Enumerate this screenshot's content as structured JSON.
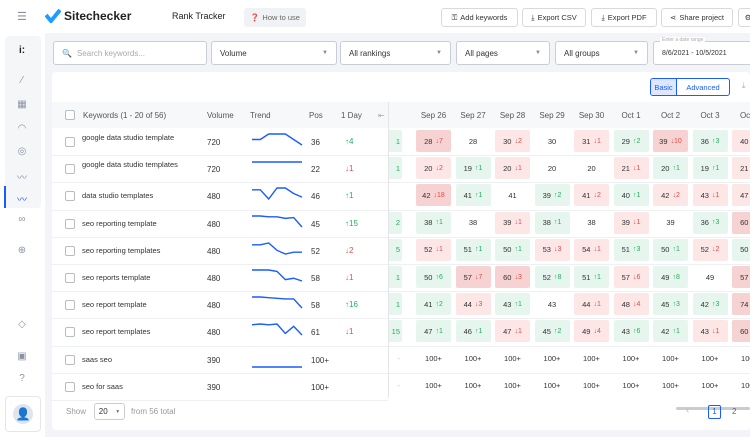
{
  "app": {
    "brand": "Sitechecker",
    "title": "Rank Tracker",
    "how_to_use": "How to use"
  },
  "toolbar": {
    "add_keywords": "Add keywords",
    "export_csv": "Export CSV",
    "export_pdf": "Export PDF",
    "share_project": "Share project"
  },
  "filters": {
    "search_placeholder": "Search keywords...",
    "volume": "Volume",
    "rankings": "All rankings",
    "pages": "All pages",
    "groups": "All groups",
    "date_label": "Enter a date range",
    "date_range": "8/6/2021 - 10/5/2021"
  },
  "view": {
    "basic": "Basic",
    "advanced": "Advanced",
    "active": "Basic"
  },
  "columns": {
    "keywords": "Keywords (1 - 20 of 56)",
    "volume": "Volume",
    "trend": "Trend",
    "pos": "Pos",
    "day": "1 Day",
    "dates": [
      "Sep 26",
      "Sep 27",
      "Sep 28",
      "Sep 29",
      "Sep 30",
      "Oct 1",
      "Oct 2",
      "Oct 3",
      "Oct 4"
    ]
  },
  "colors": {
    "accent": "#1a5cff",
    "up": "#22b05b",
    "down": "#e34b4b",
    "up_bg": "#e6f6ee",
    "down_bg": "#fce6e6",
    "down_bg_strong": "#f7d2d2"
  },
  "rows": [
    {
      "keyword": "google data studio template",
      "volume": "720",
      "pos": "36",
      "day": {
        "dir": "up",
        "v": "4"
      },
      "prev": "1",
      "trend": [
        36,
        36,
        35,
        35,
        35,
        36,
        37
      ],
      "cells": [
        [
          "28",
          "dn",
          "7"
        ],
        [
          "28",
          "",
          ""
        ],
        [
          "30",
          "dn",
          "2"
        ],
        [
          "30",
          "",
          ""
        ],
        [
          "31",
          "dn",
          "1"
        ],
        [
          "29",
          "up",
          "2"
        ],
        [
          "39",
          "dn",
          "10"
        ],
        [
          "36",
          "up",
          "3"
        ],
        [
          "40",
          "dn",
          "4"
        ]
      ]
    },
    {
      "keyword": "google data studio templates",
      "volume": "720",
      "pos": "22",
      "day": {
        "dir": "dn",
        "v": "1"
      },
      "prev": "1",
      "trend": [
        22,
        22,
        22,
        22,
        22,
        22,
        22
      ],
      "cells": [
        [
          "20",
          "dn",
          "2"
        ],
        [
          "19",
          "up",
          "1"
        ],
        [
          "20",
          "dn",
          "1"
        ],
        [
          "20",
          "",
          ""
        ],
        [
          "20",
          "",
          ""
        ],
        [
          "21",
          "dn",
          "1"
        ],
        [
          "20",
          "up",
          "1"
        ],
        [
          "19",
          "up",
          "1"
        ],
        [
          "21",
          "dn",
          "2"
        ]
      ]
    },
    {
      "keyword": "data studio templates",
      "volume": "480",
      "pos": "46",
      "day": {
        "dir": "up",
        "v": "1"
      },
      "prev": "",
      "trend": [
        42,
        42,
        47,
        41,
        41,
        44,
        46
      ],
      "cells": [
        [
          "42",
          "dn",
          "18"
        ],
        [
          "41",
          "up",
          "1"
        ],
        [
          "41",
          "",
          ""
        ],
        [
          "39",
          "up",
          "2"
        ],
        [
          "41",
          "dn",
          "2"
        ],
        [
          "40",
          "up",
          "1"
        ],
        [
          "42",
          "dn",
          "2"
        ],
        [
          "43",
          "dn",
          "1"
        ],
        [
          "47",
          "dn",
          "4"
        ]
      ]
    },
    {
      "keyword": "seo reporting template",
      "volume": "480",
      "pos": "45",
      "day": {
        "dir": "up",
        "v": "15"
      },
      "prev": "2",
      "trend": [
        38,
        38,
        39,
        39,
        41,
        40,
        52
      ],
      "cells": [
        [
          "38",
          "up",
          "1"
        ],
        [
          "38",
          "",
          ""
        ],
        [
          "39",
          "dn",
          "1"
        ],
        [
          "38",
          "up",
          "1"
        ],
        [
          "38",
          "",
          ""
        ],
        [
          "39",
          "dn",
          "1"
        ],
        [
          "39",
          "",
          ""
        ],
        [
          "36",
          "up",
          "3"
        ],
        [
          "60",
          "dn",
          "2"
        ]
      ]
    },
    {
      "keyword": "seo reporting templates",
      "volume": "480",
      "pos": "52",
      "day": {
        "dir": "dn",
        "v": "2"
      },
      "prev": "5",
      "trend": [
        50,
        50,
        49,
        53,
        55,
        54,
        54
      ],
      "cells": [
        [
          "52",
          "dn",
          "1"
        ],
        [
          "51",
          "up",
          "1"
        ],
        [
          "50",
          "up",
          "1"
        ],
        [
          "53",
          "dn",
          "3"
        ],
        [
          "54",
          "dn",
          "1"
        ],
        [
          "51",
          "up",
          "3"
        ],
        [
          "50",
          "up",
          "1"
        ],
        [
          "52",
          "dn",
          "2"
        ],
        [
          "50",
          "up",
          "2"
        ]
      ]
    },
    {
      "keyword": "seo reports template",
      "volume": "480",
      "pos": "58",
      "day": {
        "dir": "dn",
        "v": "1"
      },
      "prev": "1",
      "trend": [
        50,
        50,
        50,
        51,
        57,
        56,
        58
      ],
      "cells": [
        [
          "50",
          "up",
          "6"
        ],
        [
          "57",
          "dn",
          "7"
        ],
        [
          "60",
          "dn",
          "3"
        ],
        [
          "52",
          "up",
          "8"
        ],
        [
          "51",
          "up",
          "1"
        ],
        [
          "57",
          "dn",
          "6"
        ],
        [
          "49",
          "up",
          "8"
        ],
        [
          "49",
          "",
          ""
        ],
        [
          "57",
          "dn",
          "8"
        ]
      ]
    },
    {
      "keyword": "seo report template",
      "volume": "480",
      "pos": "58",
      "day": {
        "dir": "up",
        "v": "16"
      },
      "prev": "1",
      "trend": [
        41,
        41,
        42,
        43,
        44,
        44,
        58
      ],
      "cells": [
        [
          "41",
          "up",
          "2"
        ],
        [
          "44",
          "dn",
          "3"
        ],
        [
          "43",
          "up",
          "1"
        ],
        [
          "43",
          "",
          ""
        ],
        [
          "44",
          "dn",
          "1"
        ],
        [
          "48",
          "dn",
          "4"
        ],
        [
          "45",
          "up",
          "3"
        ],
        [
          "42",
          "up",
          "3"
        ],
        [
          "74",
          "dn",
          "3"
        ]
      ]
    },
    {
      "keyword": "seo report templates",
      "volume": "480",
      "pos": "61",
      "day": {
        "dir": "dn",
        "v": "1"
      },
      "prev": "15",
      "trend": [
        47,
        46,
        47,
        46,
        58,
        49,
        60
      ],
      "cells": [
        [
          "47",
          "up",
          "1"
        ],
        [
          "46",
          "up",
          "1"
        ],
        [
          "47",
          "dn",
          "1"
        ],
        [
          "45",
          "up",
          "2"
        ],
        [
          "49",
          "dn",
          "4"
        ],
        [
          "43",
          "up",
          "6"
        ],
        [
          "42",
          "up",
          "1"
        ],
        [
          "43",
          "dn",
          "1"
        ],
        [
          "60",
          "dn",
          "1"
        ]
      ]
    },
    {
      "keyword": "saas seo",
      "volume": "390",
      "pos": "100+",
      "day": {
        "dir": "",
        "v": ""
      },
      "prev": "-",
      "trend": [
        100,
        100,
        100,
        100,
        100,
        100,
        100
      ],
      "cells": [
        [
          "100+",
          "",
          ""
        ],
        [
          "100+",
          "",
          ""
        ],
        [
          "100+",
          "",
          ""
        ],
        [
          "100+",
          "",
          ""
        ],
        [
          "100+",
          "",
          ""
        ],
        [
          "100+",
          "",
          ""
        ],
        [
          "100+",
          "",
          ""
        ],
        [
          "100+",
          "",
          ""
        ],
        [
          "100+",
          "",
          ""
        ]
      ]
    },
    {
      "keyword": "seo for saas",
      "volume": "390",
      "pos": "100+",
      "day": {
        "dir": "",
        "v": ""
      },
      "prev": "-",
      "trend": [],
      "cells": [
        [
          "100+",
          "",
          ""
        ],
        [
          "100+",
          "",
          ""
        ],
        [
          "100+",
          "",
          ""
        ],
        [
          "100+",
          "",
          ""
        ],
        [
          "100+",
          "",
          ""
        ],
        [
          "100+",
          "",
          ""
        ],
        [
          "100+",
          "",
          ""
        ],
        [
          "100+",
          "",
          ""
        ],
        [
          "100+",
          "",
          ""
        ]
      ]
    }
  ],
  "footer": {
    "show": "Show",
    "per_page": "20",
    "total": "from 56 total",
    "pages": [
      "1",
      "2"
    ],
    "current_page": "1"
  }
}
